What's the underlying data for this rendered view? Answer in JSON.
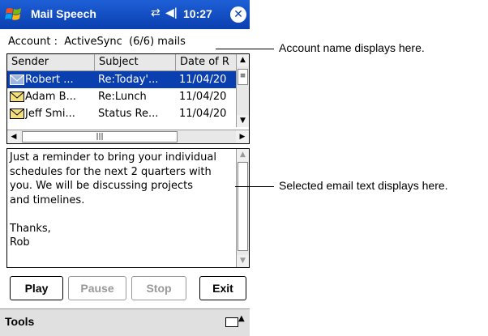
{
  "titlebar": {
    "title": "Mail Speech",
    "time": "10:27",
    "icons": [
      "windows-logo-icon",
      "sync-icon",
      "volume-icon",
      "close-icon"
    ]
  },
  "account": {
    "text": "Account :  ActiveSync  (6/6) mails"
  },
  "listview": {
    "columns": [
      "Sender",
      "Subject",
      "Date of R"
    ],
    "rows": [
      {
        "sender": "Robert ...",
        "subject": "Re:Today'...",
        "date": "11/04/20",
        "selected": true,
        "icon": "envelope-read-icon"
      },
      {
        "sender": "Adam B...",
        "subject": "Re:Lunch",
        "date": "11/04/20",
        "selected": false,
        "icon": "envelope-icon"
      },
      {
        "sender": "Jeff Smi...",
        "subject": "Status Re...",
        "date": "11/04/20",
        "selected": false,
        "icon": "envelope-icon"
      }
    ]
  },
  "message": {
    "text": "Just a reminder to bring your individual\nschedules for the next 2 quarters with\nyou. We will be discussing projects\nand timelines.\n\nThanks,\nRob"
  },
  "buttons": {
    "play": "Play",
    "pause": "Pause",
    "stop": "Stop",
    "exit": "Exit"
  },
  "menubar": {
    "tools": "Tools",
    "icons": [
      "keyboard-icon",
      "input-menu-arrow-icon"
    ]
  },
  "callouts": {
    "account": "Account name displays here.",
    "email": "Selected email text displays here."
  },
  "colors": {
    "titlebar": "#0a3fb0",
    "selection": "#0a3fb0"
  }
}
